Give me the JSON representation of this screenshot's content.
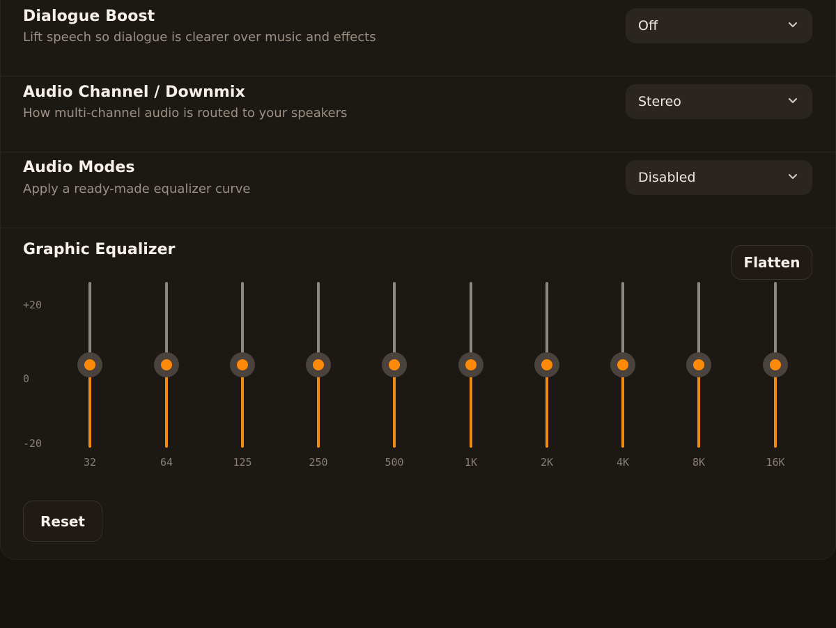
{
  "settings": [
    {
      "title": "Dialogue Boost",
      "description": "Lift speech so dialogue is clearer over music and effects",
      "value": "Off"
    },
    {
      "title": "Audio Channel / Downmix",
      "description": "How multi-channel audio is routed to your speakers",
      "value": "Stereo"
    },
    {
      "title": "Audio Modes",
      "description": "Apply a ready-made equalizer curve",
      "value": "Disabled"
    }
  ],
  "equalizer": {
    "title": "Graphic Equalizer",
    "flatten_label": "Flatten",
    "reset_label": "Reset",
    "scale": {
      "max": "+20",
      "mid": "0",
      "min": "-20"
    },
    "bands": [
      {
        "label": "32",
        "gain_db": 0
      },
      {
        "label": "64",
        "gain_db": 0
      },
      {
        "label": "125",
        "gain_db": 0
      },
      {
        "label": "250",
        "gain_db": 0
      },
      {
        "label": "500",
        "gain_db": 0
      },
      {
        "label": "1K",
        "gain_db": 0
      },
      {
        "label": "2K",
        "gain_db": 0
      },
      {
        "label": "4K",
        "gain_db": 0
      },
      {
        "label": "8K",
        "gain_db": 0
      },
      {
        "label": "16K",
        "gain_db": 0
      }
    ]
  },
  "colors": {
    "accent": "#ff8a0a",
    "background": "#1c1814"
  },
  "icons": {
    "dropdown": "chevron-down-icon"
  }
}
